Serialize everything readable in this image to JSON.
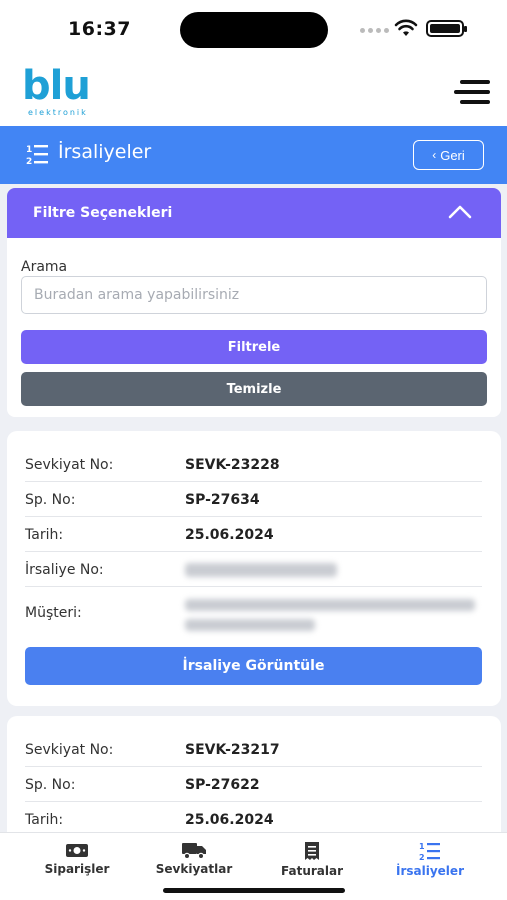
{
  "status_bar": {
    "time": "16:37"
  },
  "logo": {
    "brand": "blu",
    "tagline": "elektronik"
  },
  "title_bar": {
    "title": "İrsaliyeler",
    "back_label": "Geri"
  },
  "filter": {
    "header": "Filtre Seçenekleri",
    "search_label": "Arama",
    "search_placeholder": "Buradan arama yapabilirsiniz",
    "search_value": "",
    "filter_button": "Filtrele",
    "clear_button": "Temizle"
  },
  "records": [
    {
      "shipment_label": "Sevkiyat No:",
      "shipment_no": "SEVK-23228",
      "order_label": "Sp. No:",
      "order_no": "SP-27634",
      "date_label": "Tarih:",
      "date": "25.06.2024",
      "waybill_label": "İrsaliye No:",
      "customer_label": "Müşteri:",
      "view_button": "İrsaliye Görüntüle"
    },
    {
      "shipment_label": "Sevkiyat No:",
      "shipment_no": "SEVK-23217",
      "order_label": "Sp. No:",
      "order_no": "SP-27622",
      "date_label": "Tarih:",
      "date": "25.06.2024"
    }
  ],
  "tabs": [
    {
      "label": "Siparişler",
      "icon": "money-icon",
      "active": false
    },
    {
      "label": "Sevkiyatlar",
      "icon": "truck-icon",
      "active": false
    },
    {
      "label": "Faturalar",
      "icon": "receipt-icon",
      "active": false
    },
    {
      "label": "İrsaliyeler",
      "icon": "list-ordered-icon",
      "active": true
    }
  ],
  "colors": {
    "brand": "#1fa0d6",
    "title_bar": "#4285f4",
    "filter_accent": "#7462f5",
    "clear_button": "#5b6571",
    "view_button": "#4a80f0",
    "active_tab": "#3a74ef"
  }
}
